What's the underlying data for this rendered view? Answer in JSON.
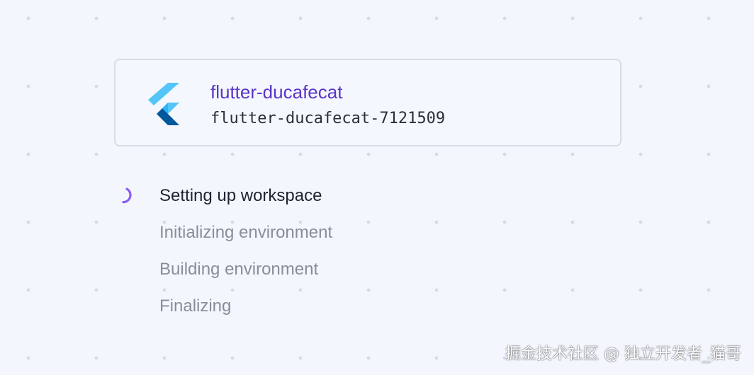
{
  "project": {
    "name": "flutter-ducafecat",
    "id": "flutter-ducafecat-7121509",
    "logo_icon": "flutter-logo-icon"
  },
  "steps": [
    {
      "label": "Setting up workspace",
      "status": "active"
    },
    {
      "label": "Initializing environment",
      "status": "pending"
    },
    {
      "label": "Building environment",
      "status": "pending"
    },
    {
      "label": "Finalizing",
      "status": "pending"
    }
  ],
  "spinner_icon": "loading-spinner-icon",
  "watermark": "掘金技术社区 @ 独立开发者_猫哥",
  "colors": {
    "accent": "#5b34c9",
    "spinner": "#8b5cf6",
    "background": "#f3f6fd",
    "text_active": "#1f2230",
    "text_pending": "#8a8d99"
  }
}
